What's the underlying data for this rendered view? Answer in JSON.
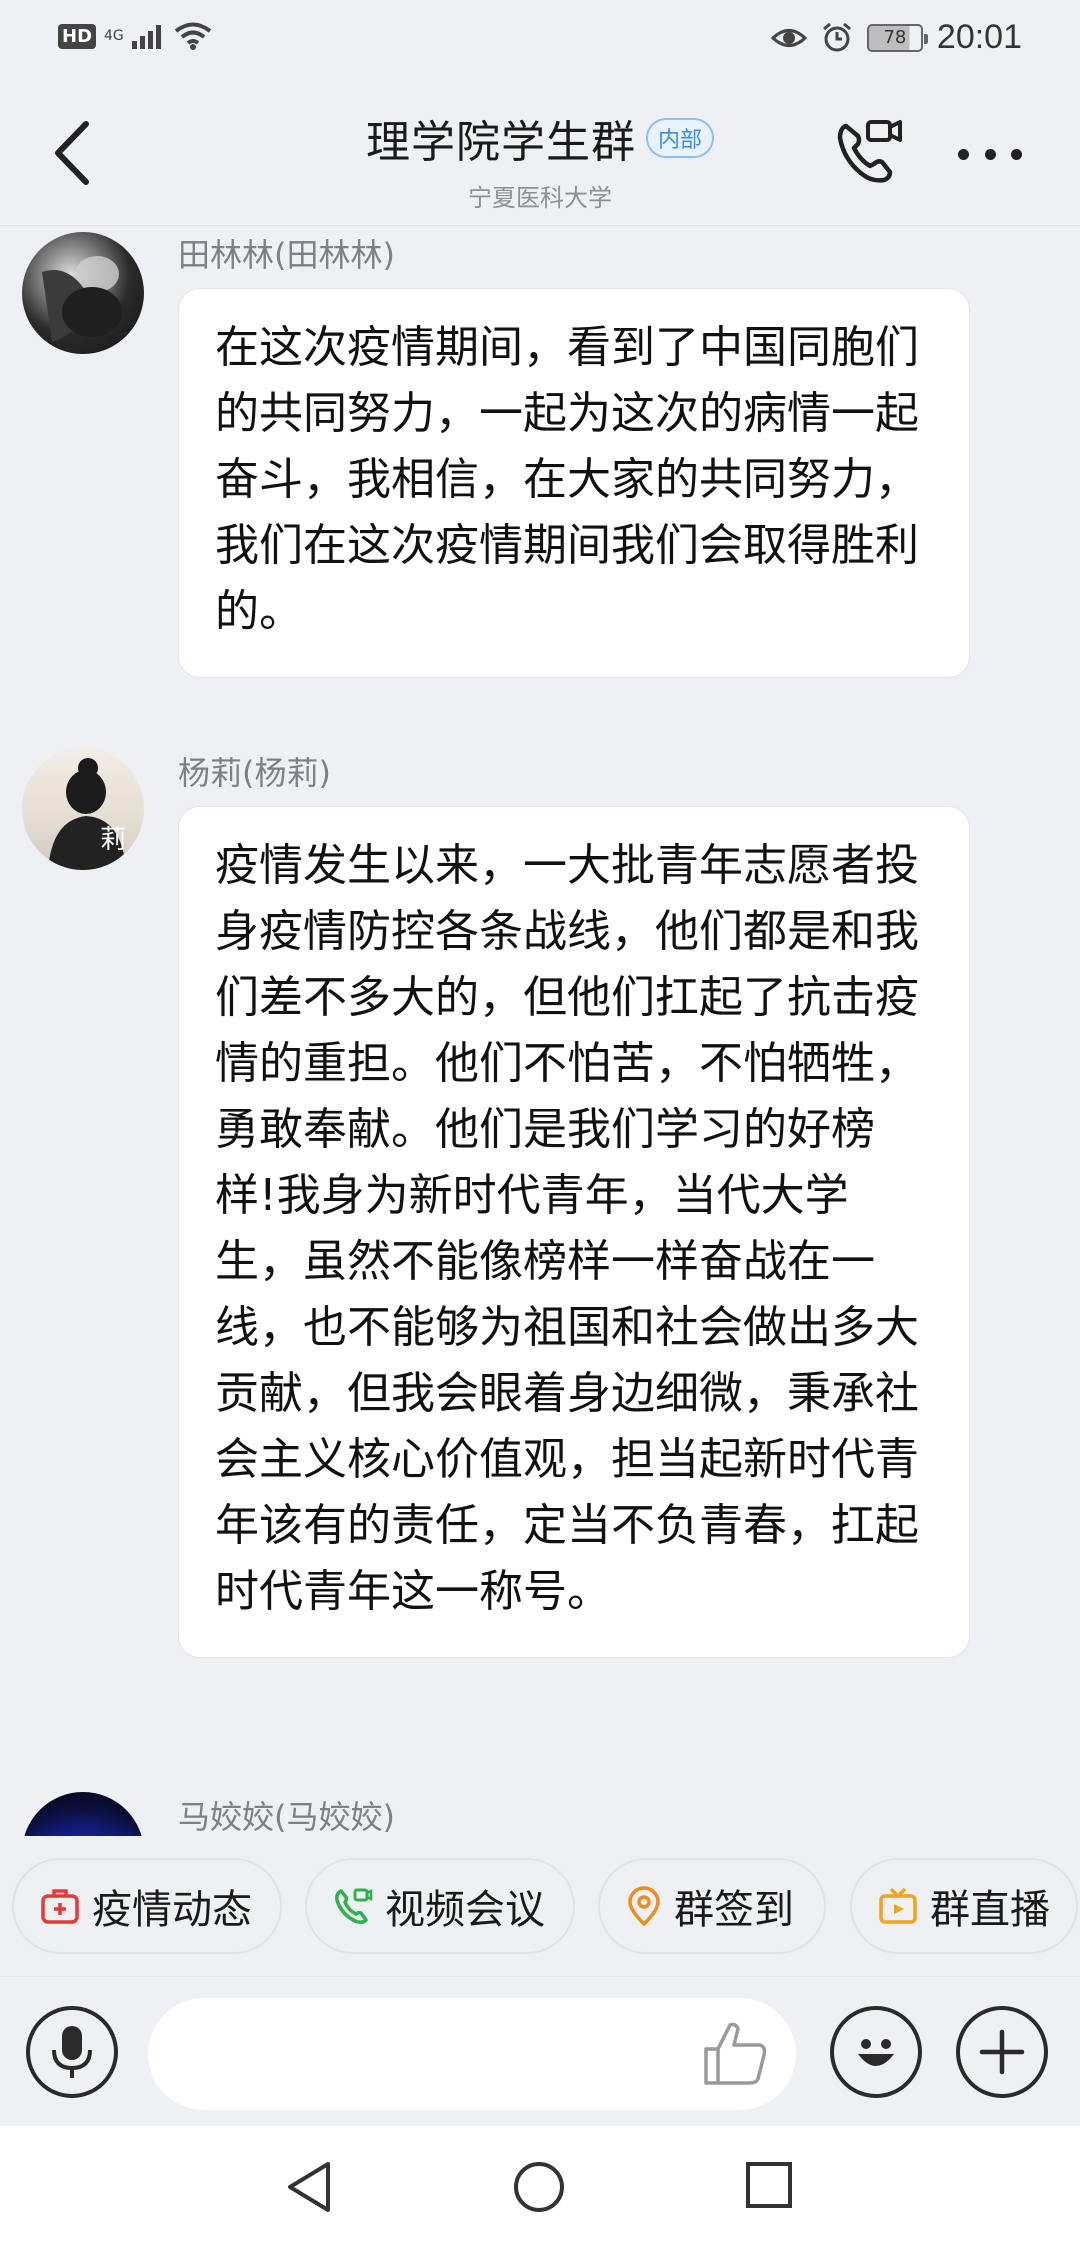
{
  "status_bar": {
    "hd": "HD",
    "network": "4G",
    "battery": "78",
    "time": "20:01"
  },
  "header": {
    "title": "理学院学生群",
    "tag": "内部",
    "subtitle": "宁夏医科大学"
  },
  "messages": [
    {
      "sender": "田林林(田林林)",
      "text": "在这次疫情期间，看到了中国同胞们的共同努力，一起为这次的病情一起奋斗，我相信，在大家的共同努力，我们在这次疫情期间我们会取得胜利的。"
    },
    {
      "sender": "杨莉(杨莉)",
      "avatar_text": "莉",
      "text": "疫情发生以来，一大批青年志愿者投身疫情防控各条战线，他们都是和我们差不多大的，但他们扛起了抗击疫情的重担。他们不怕苦，不怕牺牲，勇敢奉献。他们是我们学习的好榜样!我身为新时代青年，当代大学生，虽然不能像榜样一样奋战在一线，也不能够为祖国和社会做出多大贡献，但我会眼着身边细微，秉承社会主义核心价值观，担当起新时代青年该有的责任，定当不负青春，扛起时代青年这一称号。"
    },
    {
      "sender": "马姣姣(马姣姣)"
    }
  ],
  "quick_actions": [
    {
      "label": "疫情动态",
      "icon": "medical-kit-icon",
      "color": "#e53935"
    },
    {
      "label": "视频会议",
      "icon": "video-call-icon",
      "color": "#2bb24c"
    },
    {
      "label": "群签到",
      "icon": "location-pin-icon",
      "color": "#f08c1f"
    },
    {
      "label": "群直播",
      "icon": "live-tv-icon",
      "color": "#f0a31f"
    }
  ],
  "input": {
    "placeholder": ""
  },
  "colors": {
    "background": "#eef0f4",
    "accent": "#3a8ee6"
  }
}
